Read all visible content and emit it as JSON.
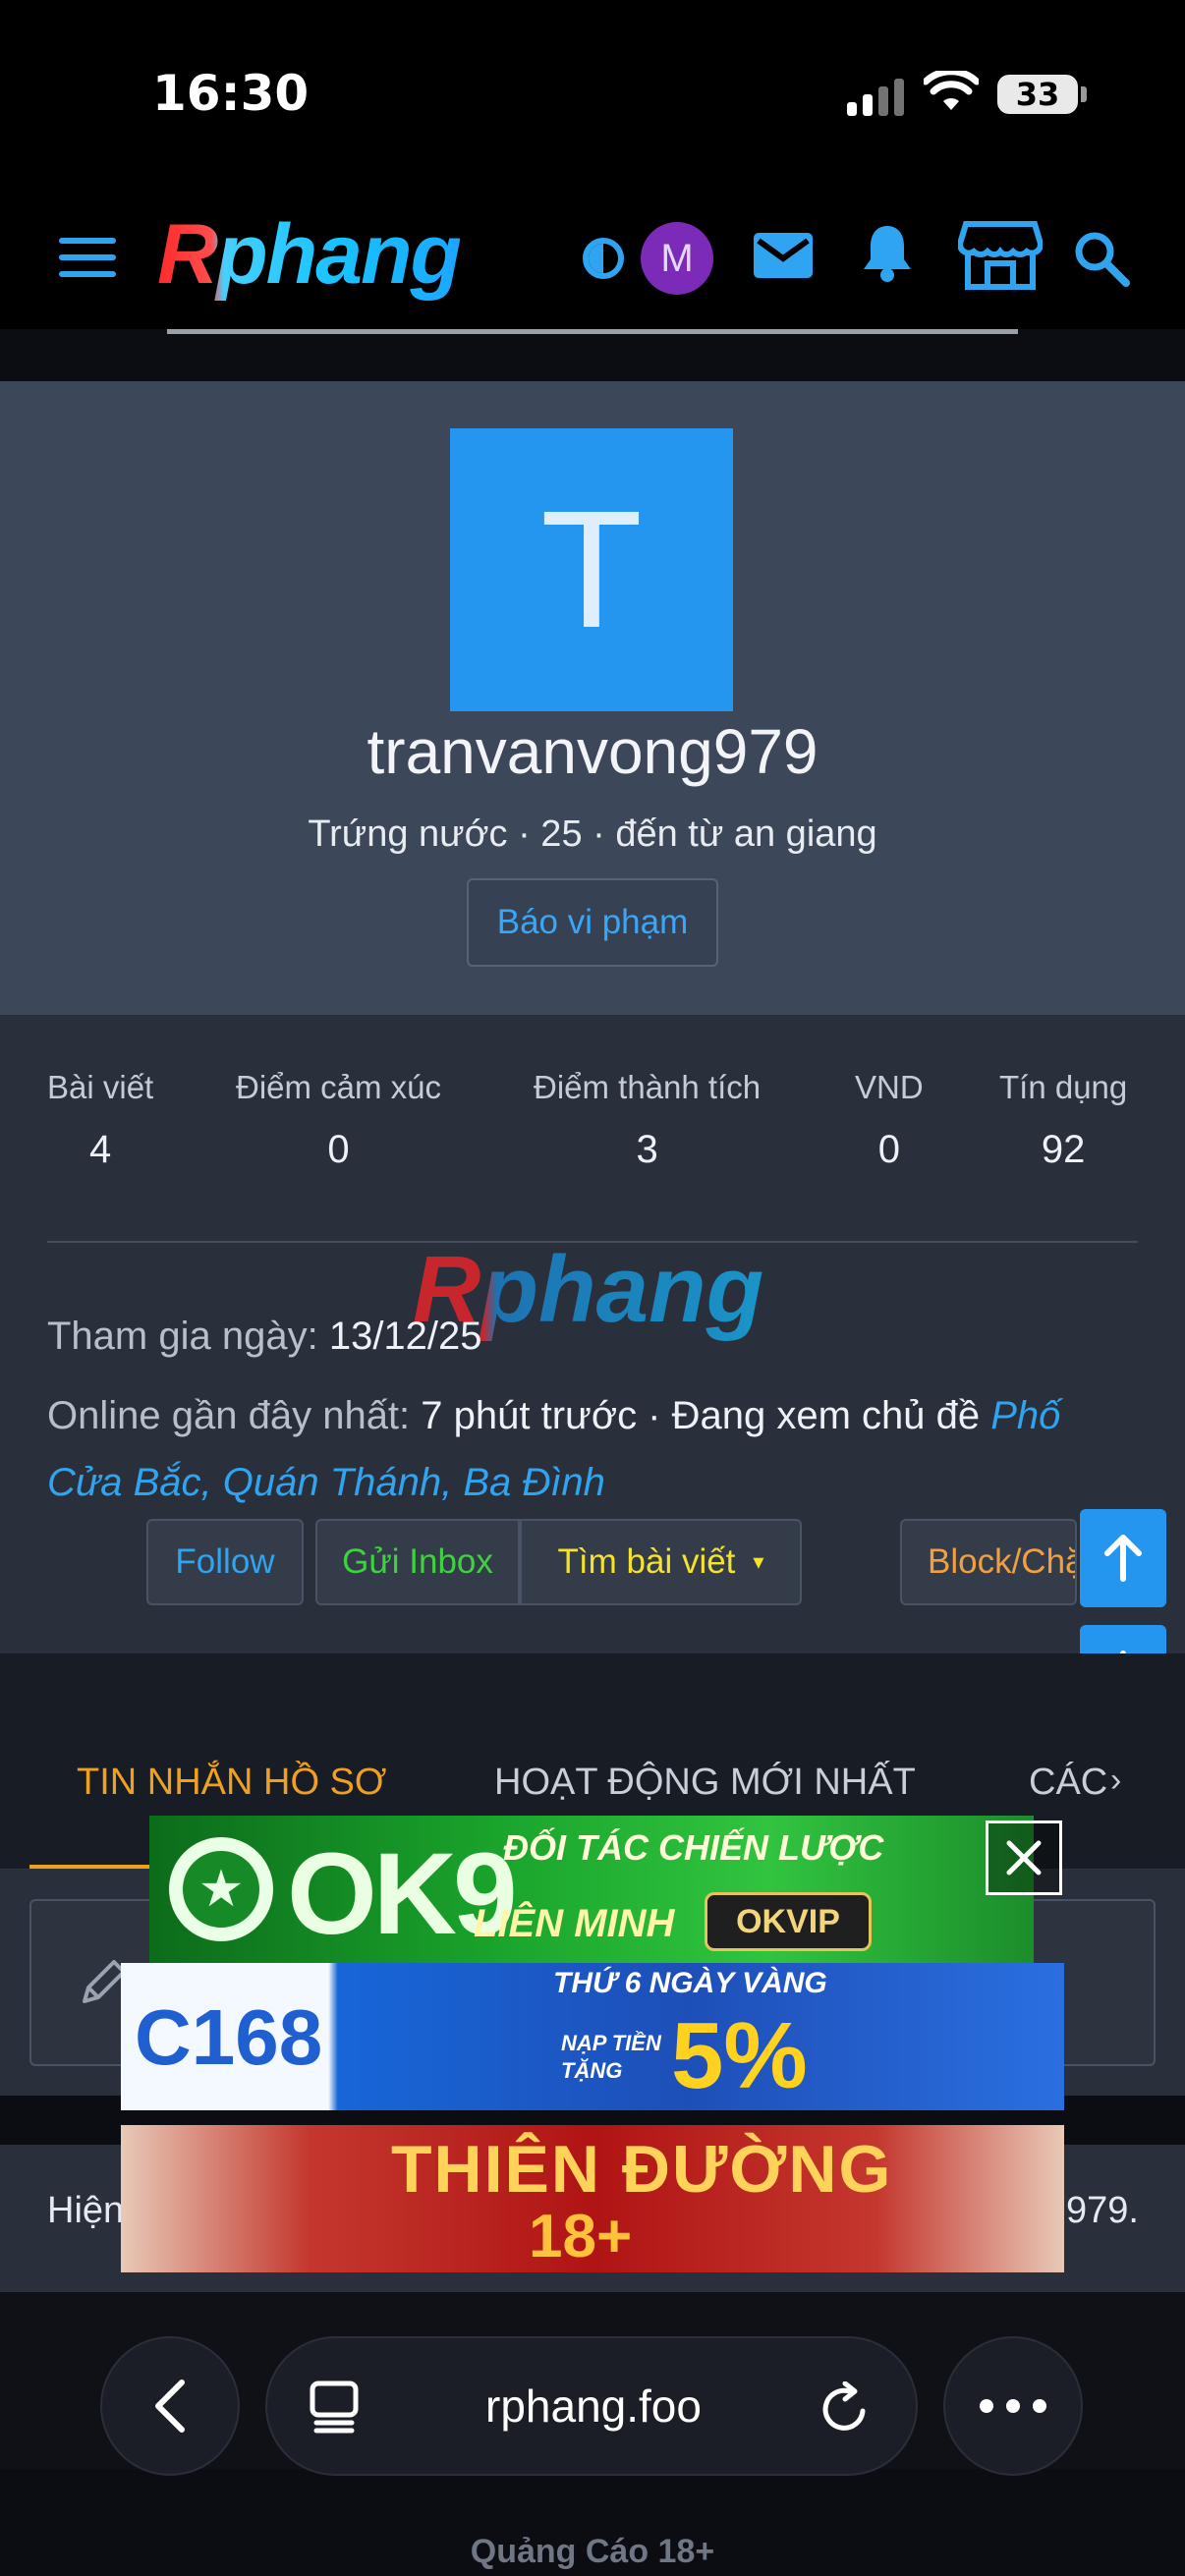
{
  "status_bar": {
    "time": "16:30",
    "battery": "33"
  },
  "header": {
    "logo": "Rphang",
    "avatar_initial": "M"
  },
  "profile": {
    "avatar_initial": "T",
    "username": "tranvanvong979",
    "meta": "Trứng nước · 25 · đến từ an giang",
    "report_label": "Báo vi phạm"
  },
  "stats": [
    {
      "label": "Bài viết",
      "value": "4"
    },
    {
      "label": "Điểm cảm xúc",
      "value": "0"
    },
    {
      "label": "Điểm thành tích",
      "value": "3"
    },
    {
      "label": "VND",
      "value": "0"
    },
    {
      "label": "Tín dụng",
      "value": "92"
    }
  ],
  "watermark": "Rphang",
  "info": {
    "joined_label": "Tham gia ngày:",
    "joined_value": "13/12/25",
    "online_label": "Online gần đây nhất:",
    "online_value": "7 phút trước · Đang xem chủ đề",
    "thread_line1": "Phố",
    "thread_line2": "Cửa Bắc, Quán Thánh, Ba Đình"
  },
  "actions": {
    "follow": "Follow",
    "inbox": "Gửi Inbox",
    "find_posts": "Tìm bài viết",
    "block": "Block/Chặn"
  },
  "tabs": [
    {
      "label": "TIN NHẮN HỒ SƠ",
      "active": true
    },
    {
      "label": "HOẠT ĐỘNG MỚI NHẤT",
      "active": false
    },
    {
      "label": "CÁC",
      "active": false
    }
  ],
  "currently": {
    "left": "Hiện",
    "right": "979."
  },
  "ads": {
    "ok9_brand": "OK9",
    "ok9_line1": "ĐỐI TÁC CHIẾN LƯỢC",
    "ok9_line2": "LIÊN MINH",
    "ok9_partner": "OKVIP",
    "c168_brand": "C168",
    "c168_line1": "THỨ 6 NGÀY VÀNG",
    "c168_line2": "NẠP TIỀN TẶNG",
    "c168_percent": "5%",
    "adult_line1": "THIÊN ĐƯỜNG",
    "adult_line2": "18+"
  },
  "browser": {
    "url": "rphang.foo"
  },
  "footer_label": "Quảng Cáo 18+",
  "colors": {
    "accent_blue": "#2596f0",
    "tab_active": "#f0a020",
    "inbox_green": "#3fd23f",
    "find_yellow": "#f5e22a",
    "block_orange": "#f0a040"
  }
}
